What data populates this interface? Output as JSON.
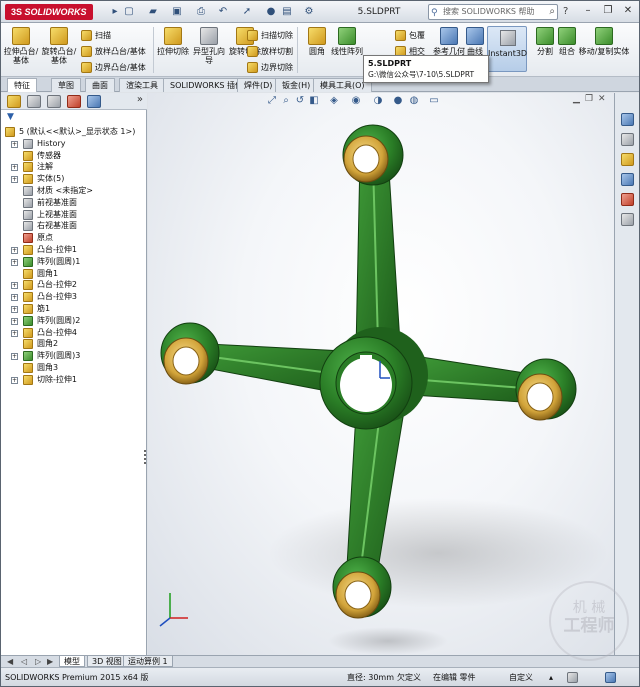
{
  "app": {
    "logo_prefix": "3S",
    "logo_text": "SOLIDWORKS",
    "document_title": "5.SLDPRT",
    "search_placeholder": "搜索 SOLIDWORKS 帮助"
  },
  "ribbon": {
    "extrude_boss": "拉伸凸台/基体",
    "revolve_boss": "旋转凸台/基体",
    "sweep": "扫描",
    "loft": "放样凸台/基体",
    "boundary_boss": "边界凸台/基体",
    "extrude_cut": "拉伸切除",
    "hole_wizard": "异型孔向导",
    "revolve_cut": "旋转切除",
    "swept_cut": "扫描切除",
    "lofted_cut": "放样切割",
    "boundary_cut": "边界切除",
    "fillet": "圆角",
    "linear_pattern": "线性阵列",
    "wrap": "包覆",
    "intersect": "相交",
    "reference_geometry": "参考几何体",
    "curves": "曲线",
    "instant3d": "Instant3D",
    "split": "分割",
    "combine": "组合",
    "move_copy": "移动/复制实体"
  },
  "tabs": [
    "特征",
    "草图",
    "曲面",
    "渲染工具",
    "SOLIDWORKS 插件",
    "焊件(D)",
    "钣金(H)",
    "模具工具(O)"
  ],
  "tooltip": {
    "title": "5.SLDPRT",
    "path": "G:\\微信公众号\\7-10\\5.SLDPRT"
  },
  "tree": {
    "root": "5 (默认<<默认>_显示状态 1>)",
    "items": [
      "History",
      "传感器",
      "注解",
      "实体(5)",
      "材质 <未指定>",
      "前视基准面",
      "上视基准面",
      "右视基准面",
      "原点",
      "凸台-拉伸1",
      "阵列(圆周)1",
      "圆角1",
      "凸台-拉伸2",
      "凸台-拉伸3",
      "筋1",
      "阵列(圆周)2",
      "凸台-拉伸4",
      "圆角2",
      "阵列(圆周)3",
      "圆角3",
      "切除-拉伸1"
    ]
  },
  "model_tabs": [
    "模型",
    "3D 视图",
    "运动算例 1"
  ],
  "status": {
    "version": "SOLIDWORKS Premium 2015 x64 版",
    "diameter": "直径: 30mm",
    "under_defined": "欠定义",
    "editing": "在编辑 零件",
    "custom": "自定义"
  },
  "colors": {
    "part_green": "#2f8a2a",
    "bushing_gold": "#d2a43a",
    "brand_red": "#c8102e"
  },
  "watermark": {
    "line1": "机 械",
    "line2": "工程师"
  }
}
